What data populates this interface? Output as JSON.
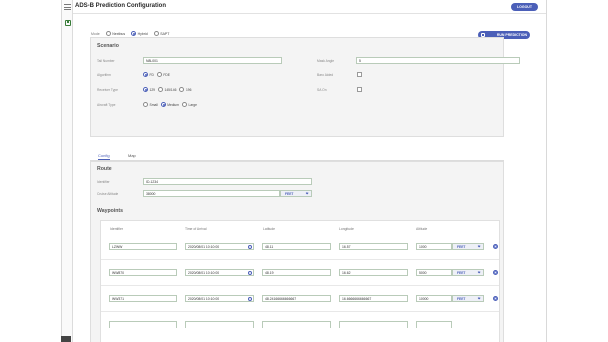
{
  "app": {
    "title": "ADS-B Prediction Configuration",
    "logout_label": "LOGOUT"
  },
  "mode": {
    "label": "Mode",
    "options": [
      {
        "label": "Nextbus",
        "selected": false
      },
      {
        "label": "Hybrid",
        "selected": true
      },
      {
        "label": "SAPT",
        "selected": false
      }
    ],
    "run_label": "RUN PREDICTION"
  },
  "scenario": {
    "heading": "Scenario",
    "tail_number_label": "Tail Number",
    "tail_number_value": "N8L001",
    "mask_angle_label": "Mask Angle",
    "mask_angle_value": "5",
    "algorithm_label": "Algorithm",
    "algorithm_options": [
      {
        "label": "FD",
        "selected": true
      },
      {
        "label": "FDE",
        "selected": false
      }
    ],
    "baro_aided_label": "Baro Aided",
    "receiver_type_label": "Receiver Type",
    "receiver_options": [
      {
        "label": "129",
        "selected": true
      },
      {
        "label": "145/146",
        "selected": false
      },
      {
        "label": "196",
        "selected": false
      }
    ],
    "sa_on_label": "SA On",
    "aircraft_type_label": "Aircraft Type",
    "aircraft_options": [
      {
        "label": "Small",
        "selected": false
      },
      {
        "label": "Medium",
        "selected": true
      },
      {
        "label": "Large",
        "selected": false
      }
    ]
  },
  "tabs": [
    {
      "label": "Config",
      "active": true
    },
    {
      "label": "Map",
      "active": false
    }
  ],
  "route": {
    "heading": "Route",
    "identifier_label": "Identifier",
    "identifier_value": "ID-1234",
    "cruise_altitude_label": "Cruise Altitude",
    "cruise_altitude_value": "38000",
    "cruise_unit": "FEET"
  },
  "waypoints": {
    "heading": "Waypoints",
    "columns": [
      "Identifier",
      "Time of Arrival",
      "Latitude",
      "Longitude",
      "Altitude"
    ],
    "rows": [
      {
        "identifier": "LZWW",
        "time": "2020/08/01 10:10:00",
        "latitude": "48.11",
        "longitude": "16.57",
        "altitude": "1000",
        "unit": "FEET"
      },
      {
        "identifier": "WW870",
        "time": "2020/08/01 10:10:00",
        "latitude": "48.19",
        "longitude": "16.62",
        "altitude": "5000",
        "unit": "FEET"
      },
      {
        "identifier": "WW371",
        "time": "2020/08/01 10:10:00",
        "latitude": "48.24166666666667",
        "longitude": "16.6666666666667",
        "altitude": "10000",
        "unit": "FEET"
      }
    ]
  },
  "colors": {
    "accent": "#4b5fb8",
    "panel": "#f4f4f4",
    "field_border": "#b9cbb9"
  },
  "icons": {
    "menu": "hamburger-icon",
    "save": "save-icon",
    "run": "play-icon",
    "calendar": "calendar-icon",
    "settings": "gear-icon",
    "dropdown": "chevron-down-icon"
  }
}
